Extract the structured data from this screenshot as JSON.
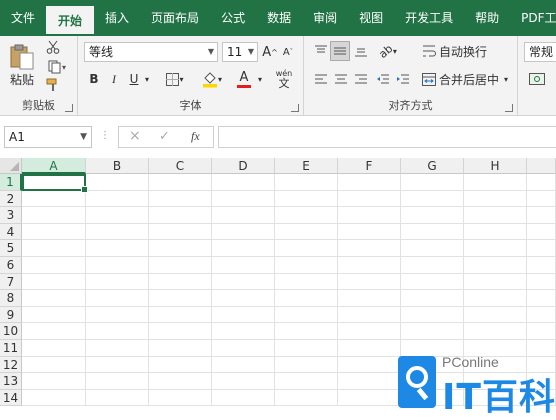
{
  "tabs": [
    "文件",
    "开始",
    "插入",
    "页面布局",
    "公式",
    "数据",
    "审阅",
    "视图",
    "开发工具",
    "帮助",
    "PDF工具集"
  ],
  "active_tab": "开始",
  "clipboard": {
    "paste_label": "粘贴",
    "group_label": "剪贴板"
  },
  "font": {
    "name": "等线",
    "size": "11",
    "bold": "B",
    "italic": "I",
    "underline": "U",
    "grow": "A",
    "shrink": "A",
    "font_color_letter": "A",
    "wen": "wén",
    "group_label": "字体"
  },
  "alignment": {
    "wrap_text": "自动换行",
    "merge_center": "合并后居中",
    "group_label": "对齐方式"
  },
  "number": {
    "format": "常规"
  },
  "formula_bar": {
    "name_box": "A1",
    "cancel": "×",
    "enter": "✓",
    "fx": "fx",
    "value": ""
  },
  "columns": [
    "A",
    "B",
    "C",
    "D",
    "E",
    "F",
    "G",
    "H"
  ],
  "rows": [
    "1",
    "2",
    "3",
    "4",
    "5",
    "6",
    "7",
    "8",
    "9",
    "10",
    "11",
    "12",
    "13",
    "14"
  ],
  "selected_cell": "A1",
  "watermark": {
    "brand": "PConline",
    "title": "IT百科"
  },
  "colors": {
    "accent": "#217346",
    "watermark_blue": "#1e88e5"
  }
}
